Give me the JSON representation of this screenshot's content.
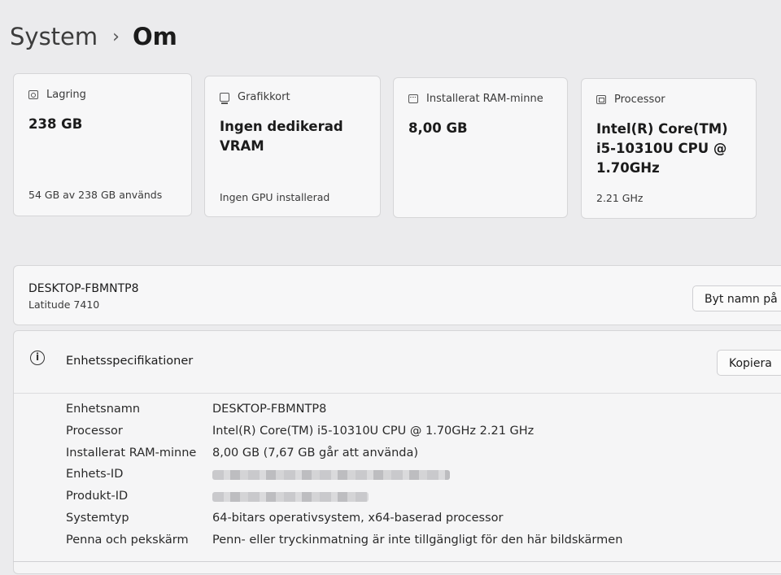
{
  "breadcrumb": {
    "parent": "System",
    "separator": "›",
    "current": "Om"
  },
  "cards": [
    {
      "icon": "storage-icon",
      "label": "Lagring",
      "value": "238 GB",
      "sub": "54 GB av 238 GB används"
    },
    {
      "icon": "graphics-card-icon",
      "label": "Grafikkort",
      "value": "Ingen dedikerad VRAM",
      "sub": "Ingen GPU installerad"
    },
    {
      "icon": "ram-icon",
      "label": "Installerat RAM-minne",
      "value": "8,00 GB",
      "sub": ""
    },
    {
      "icon": "processor-icon",
      "label": "Processor",
      "value": "Intel(R) Core(TM) i5-10310U CPU @ 1.70GHz",
      "sub": "2.21 GHz"
    }
  ],
  "device": {
    "name": "DESKTOP-FBMNTP8",
    "model": "Latitude 7410",
    "rename_button": "Byt namn på d"
  },
  "specs": {
    "title": "Enhetsspecifikationer",
    "info_icon": "i",
    "copy_button": "Kopiera",
    "rows": [
      {
        "label": "Enhetsnamn",
        "value": "DESKTOP-FBMNTP8"
      },
      {
        "label": "Processor",
        "value": "Intel(R) Core(TM) i5-10310U CPU @ 1.70GHz   2.21 GHz"
      },
      {
        "label": "Installerat RAM-minne",
        "value": "8,00 GB (7,67 GB går att använda)"
      },
      {
        "label": "Enhets-ID",
        "value": ""
      },
      {
        "label": "Produkt-ID",
        "value": ""
      },
      {
        "label": "Systemtyp",
        "value": "64-bitars operativsystem, x64-baserad processor"
      },
      {
        "label": "Penna och pekskärm",
        "value": "Penn- eller tryckinmatning är inte tillgängligt för den här bildskärmen"
      }
    ]
  }
}
